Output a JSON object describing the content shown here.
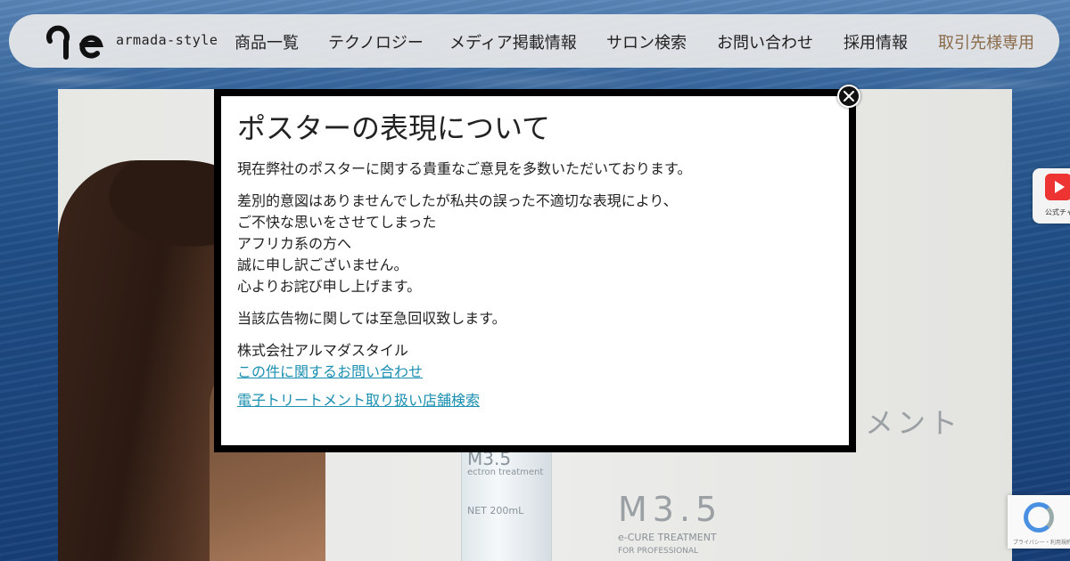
{
  "header": {
    "logo_text": "armada-style",
    "nav": [
      {
        "label": "商品一覧"
      },
      {
        "label": "テクノロジー"
      },
      {
        "label": "メディア掲載情報"
      },
      {
        "label": "サロン検索"
      },
      {
        "label": "お問い合わせ"
      },
      {
        "label": "採用情報"
      },
      {
        "label": "取引先様専用"
      }
    ]
  },
  "poster": {
    "bottle_model": "M3.5",
    "bottle_subtitle": "ectron treatment",
    "bottle_volume": "NET 200mL",
    "product_title": "M3.5",
    "product_subtitle": "e-CURE TREATMENT",
    "product_subtitle2": "FOR PROFESSIONAL",
    "kana_fragment": "メント"
  },
  "side_tab": {
    "label": "公式チャ",
    "icon": "youtube-icon"
  },
  "recaptcha": {
    "label": "プライバシー・利用規約",
    "icon": "recaptcha-icon"
  },
  "modal": {
    "title": "ポスターの表現について",
    "para1": "現在弊社のポスターに関する貴重なご意見を多数いただいております。",
    "para2_lines": [
      "差別的意図はありませんでしたが私共の誤った不適切な表現により、",
      "ご不快な思いをさせてしまった",
      "アフリカ系の方へ",
      "誠に申し訳ございません。",
      "心よりお詫び申し上げます。"
    ],
    "para3": "当該広告物に関しては至急回収致します。",
    "company": "株式会社アルマダスタイル",
    "link_contact": "この件に関するお問い合わせ",
    "link_store": "電子トリートメント取り扱い店舗検索",
    "close_icon": "close-icon"
  },
  "colors": {
    "link": "#1a8fb0",
    "nav_trade": "#8a6a4a",
    "background": "#1f4e86"
  }
}
